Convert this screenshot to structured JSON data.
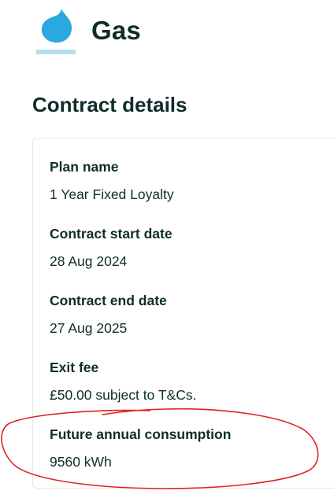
{
  "header": {
    "title": "Gas",
    "icon": "gas-flame-icon",
    "icon_color": "#29a9e0",
    "icon_base_color": "#b6def3"
  },
  "section": {
    "title": "Contract details"
  },
  "contract": {
    "fields": [
      {
        "label": "Plan name",
        "value": "1 Year Fixed Loyalty"
      },
      {
        "label": "Contract start date",
        "value": "28 Aug 2024"
      },
      {
        "label": "Contract end date",
        "value": "27 Aug 2025"
      },
      {
        "label": "Exit fee",
        "value": "£50.00 subject to T&Cs."
      },
      {
        "label": "Future annual consumption",
        "value": "9560 kWh"
      }
    ]
  },
  "annotation": {
    "shape": "hand-drawn-ellipse",
    "color": "#e0211f"
  }
}
